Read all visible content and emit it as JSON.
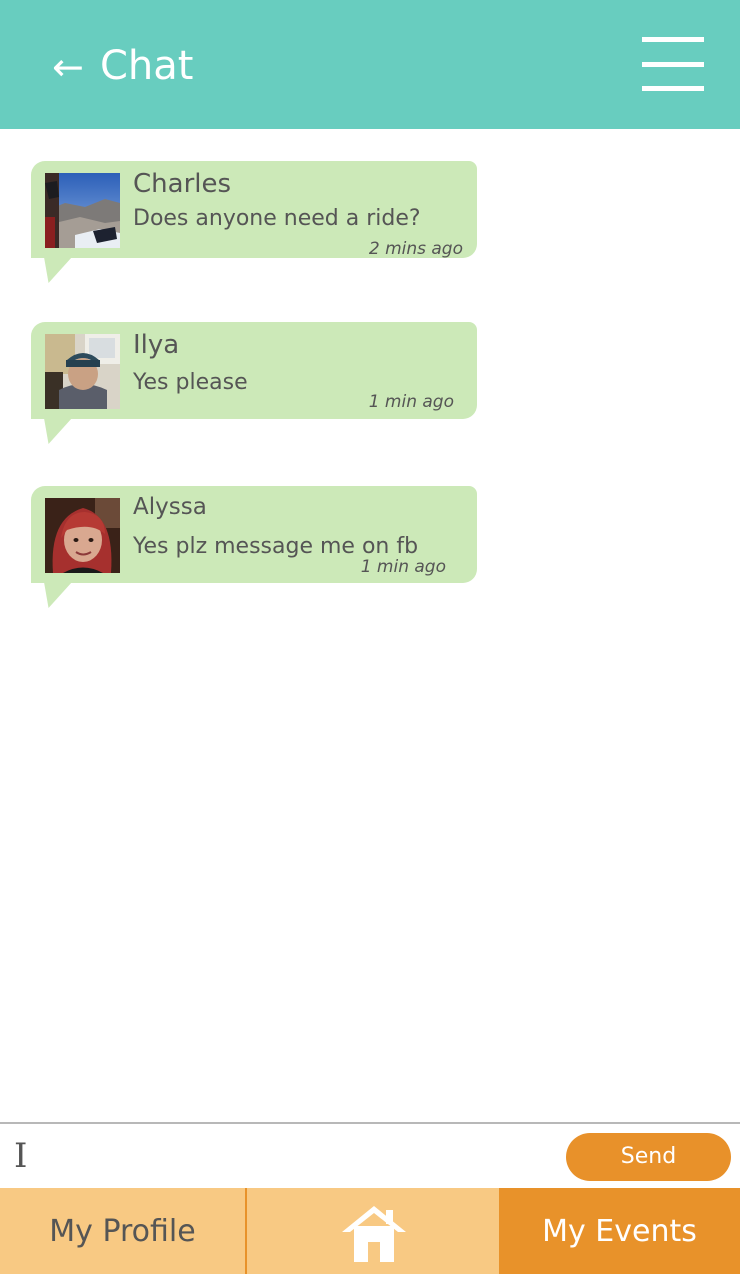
{
  "header": {
    "back_icon": "←",
    "title": "Chat",
    "menu_icon": "hamburger-icon",
    "color": "#68cdbf"
  },
  "messages": [
    {
      "sender": "Charles",
      "text": "Does anyone need a ride?",
      "time": "2 mins ago"
    },
    {
      "sender": "Ilya",
      "text": "Yes please",
      "time": "1 min ago"
    },
    {
      "sender": "Alyssa",
      "text": "Yes plz message me on fb",
      "time": "1 min ago"
    }
  ],
  "bubble_color": "#cce9b8",
  "composer": {
    "cursor_glyph": "I",
    "input_value": "",
    "send_label": "Send",
    "send_color": "#e8912a"
  },
  "bottom_nav": {
    "profile_label": "My Profile",
    "home_icon": "home-icon",
    "events_label": "My Events",
    "inactive_color": "#f8c983",
    "active_color": "#e8922a"
  }
}
